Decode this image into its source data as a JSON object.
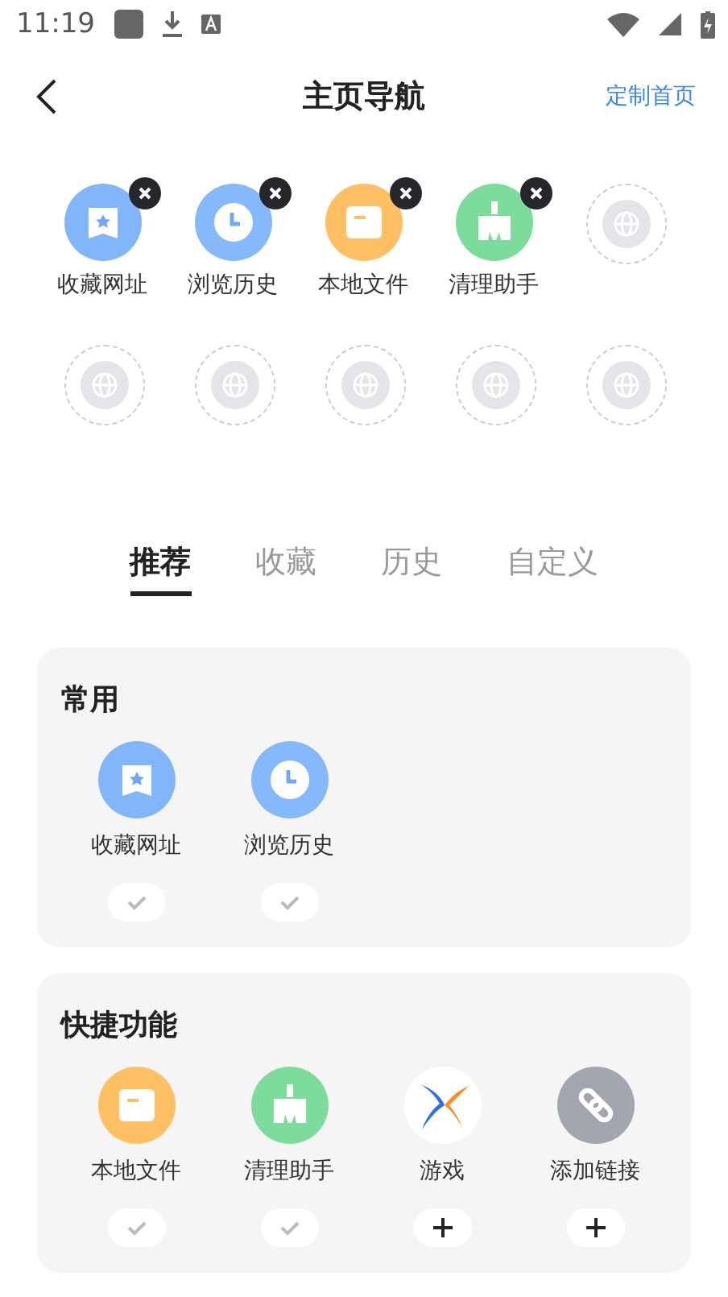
{
  "status_bar": {
    "time": "11:19"
  },
  "header": {
    "title": "主页导航",
    "action": "定制首页"
  },
  "slots": [
    {
      "kind": "star",
      "label": "收藏网址"
    },
    {
      "kind": "clock",
      "label": "浏览历史"
    },
    {
      "kind": "folder",
      "label": "本地文件"
    },
    {
      "kind": "brush",
      "label": "清理助手"
    },
    {
      "kind": "empty"
    },
    {
      "kind": "empty"
    },
    {
      "kind": "empty"
    },
    {
      "kind": "empty"
    },
    {
      "kind": "empty"
    },
    {
      "kind": "empty"
    }
  ],
  "tabs": [
    {
      "label": "推荐",
      "selected": true
    },
    {
      "label": "收藏",
      "selected": false
    },
    {
      "label": "历史",
      "selected": false
    },
    {
      "label": "自定义",
      "selected": false
    }
  ],
  "sections": [
    {
      "title": "常用",
      "items": [
        {
          "kind": "star",
          "label": "收藏网址",
          "added": true
        },
        {
          "kind": "clock",
          "label": "浏览历史",
          "added": true
        }
      ]
    },
    {
      "title": "快捷功能",
      "items": [
        {
          "kind": "folder",
          "label": "本地文件",
          "added": true
        },
        {
          "kind": "brush",
          "label": "清理助手",
          "added": true
        },
        {
          "kind": "game",
          "label": "游戏",
          "added": false
        },
        {
          "kind": "link",
          "label": "添加链接",
          "added": false
        }
      ]
    }
  ]
}
